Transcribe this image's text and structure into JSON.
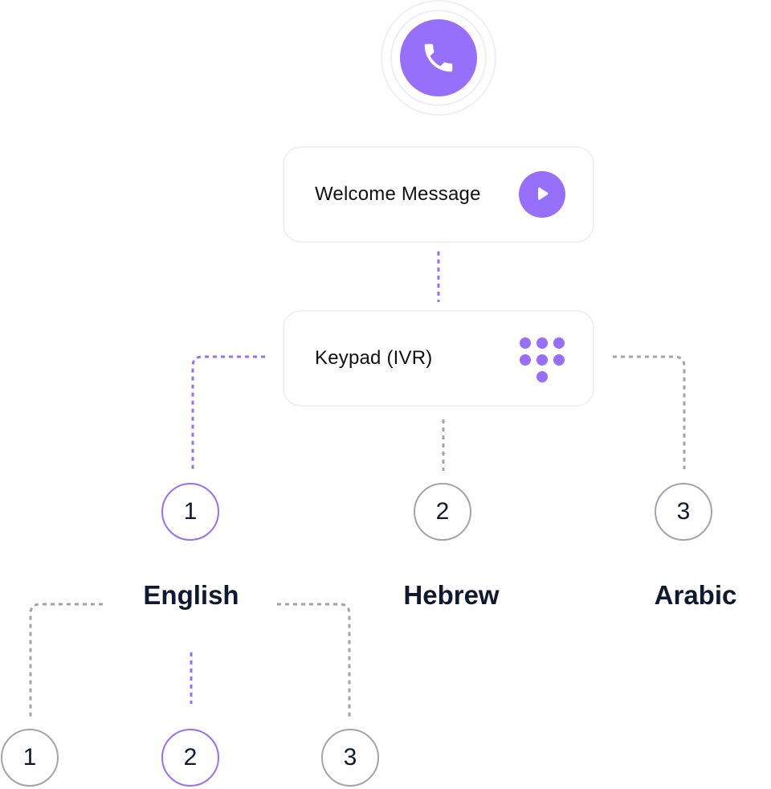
{
  "colors": {
    "accent": "#9670fb",
    "inactive_line": "#a3a3ab",
    "text_dark": "#111831",
    "card_border": "#f1f1f3"
  },
  "call": {
    "icon": "phone-icon"
  },
  "welcome": {
    "label": "Welcome Message",
    "icon": "play-icon"
  },
  "keypad": {
    "label": "Keypad (IVR)",
    "icon": "keypad-icon"
  },
  "level1": {
    "options": [
      {
        "number": "1",
        "language": "English",
        "active": true
      },
      {
        "number": "2",
        "language": "Hebrew",
        "active": false
      },
      {
        "number": "3",
        "language": "Arabic",
        "active": false
      }
    ]
  },
  "level2": {
    "parent": "English",
    "options": [
      {
        "number": "1",
        "active": false
      },
      {
        "number": "2",
        "active": true
      },
      {
        "number": "3",
        "active": false
      }
    ]
  }
}
